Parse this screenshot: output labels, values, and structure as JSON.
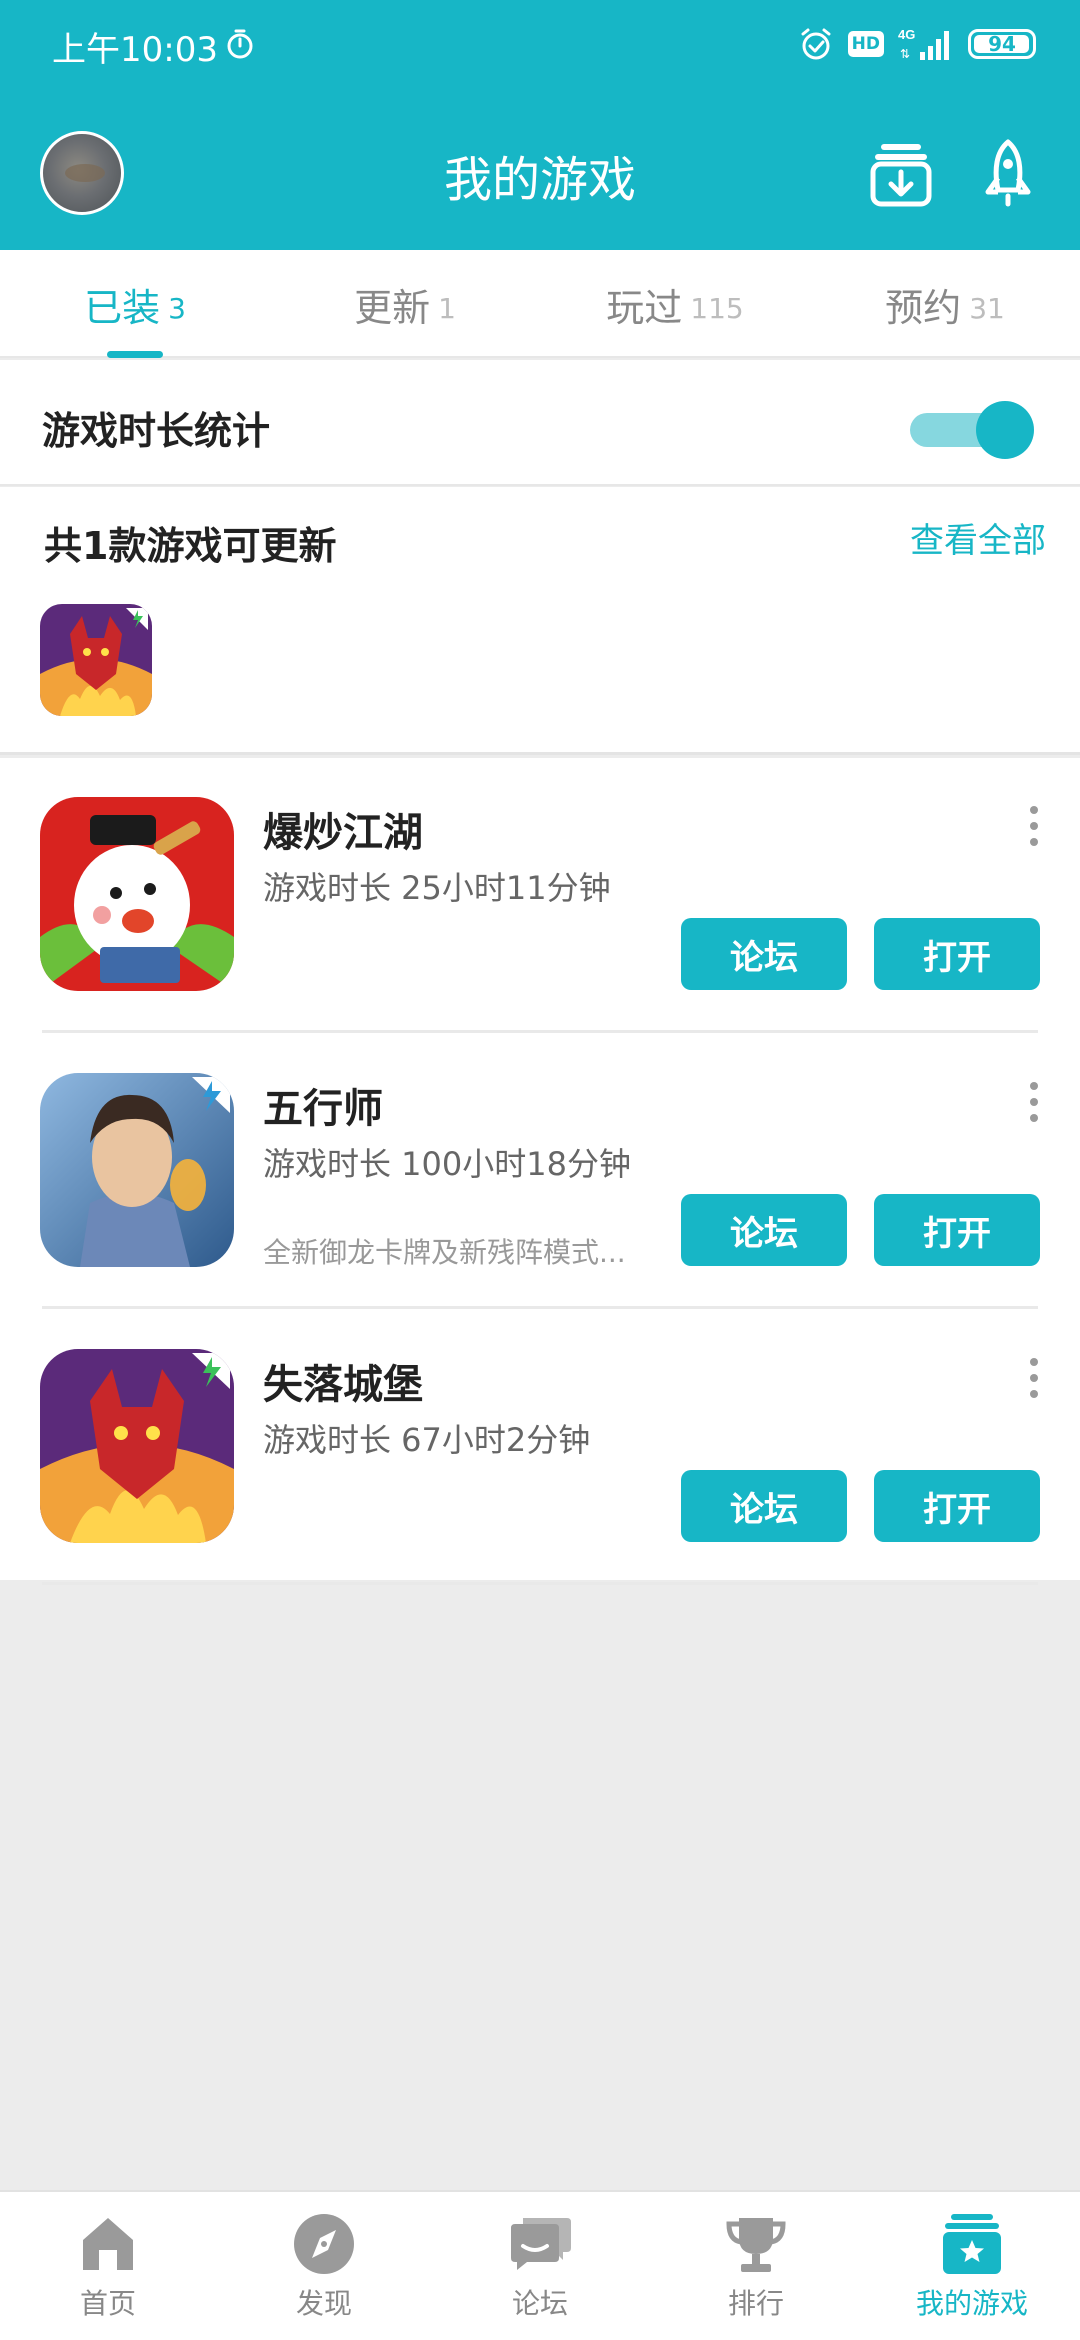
{
  "status_bar": {
    "time": "上午10:03",
    "hd": "HD",
    "network": "4G",
    "battery": "94"
  },
  "header": {
    "title": "我的游戏"
  },
  "tabs": [
    {
      "label": "已装",
      "count": "3",
      "active": true
    },
    {
      "label": "更新",
      "count": "1",
      "active": false
    },
    {
      "label": "玩过",
      "count": "115",
      "active": false
    },
    {
      "label": "预约",
      "count": "31",
      "active": false
    }
  ],
  "stats": {
    "label": "游戏时长统计",
    "enabled": true
  },
  "update": {
    "title": "共1款游戏可更新",
    "view_all": "查看全部"
  },
  "games": [
    {
      "name": "爆炒江湖",
      "playtime": "游戏时长 25小时11分钟",
      "desc": "",
      "forum_label": "论坛",
      "open_label": "打开"
    },
    {
      "name": "五行师",
      "playtime": "游戏时长 100小时18分钟",
      "desc": "全新御龙卡牌及新残阵模式...",
      "forum_label": "论坛",
      "open_label": "打开"
    },
    {
      "name": "失落城堡",
      "playtime": "游戏时长 67小时2分钟",
      "desc": "",
      "forum_label": "论坛",
      "open_label": "打开"
    }
  ],
  "bottom_nav": [
    {
      "label": "首页",
      "icon": "home-icon",
      "active": false
    },
    {
      "label": "发现",
      "icon": "compass-icon",
      "active": false
    },
    {
      "label": "论坛",
      "icon": "chat-icon",
      "active": false
    },
    {
      "label": "排行",
      "icon": "trophy-icon",
      "active": false
    },
    {
      "label": "我的游戏",
      "icon": "my-games-icon",
      "active": true
    }
  ],
  "colors": {
    "accent": "#17b6c6",
    "accent_light": "#86d7df",
    "background": "#ececec",
    "inactive": "#888888"
  }
}
